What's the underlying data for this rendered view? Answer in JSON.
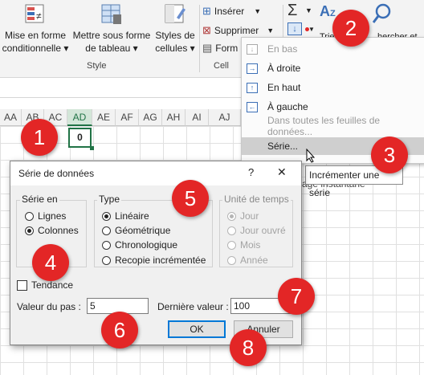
{
  "ribbon": {
    "btn_mise_forme": "Mise en forme",
    "btn_mise_forme_2": "conditionnelle",
    "btn_tableau": "Mettre sous forme",
    "btn_tableau_2": "de tableau",
    "btn_styles": "Styles de",
    "btn_styles_2": "cellules",
    "group_style": "Style",
    "insert": "Insérer",
    "delete": "Supprimer",
    "format": "Form",
    "group_cells": "Cell",
    "sort_filter": "Trier",
    "find": "hercher et"
  },
  "fill_menu": {
    "items": [
      {
        "label": "En bas",
        "disabled": true,
        "icon": "fill-down-icon",
        "glyph": "↓"
      },
      {
        "label": "À droite",
        "disabled": false,
        "icon": "fill-right-icon",
        "glyph": "→"
      },
      {
        "label": "En haut",
        "disabled": false,
        "icon": "fill-up-icon",
        "glyph": "↑"
      },
      {
        "label": "À gauche",
        "disabled": false,
        "icon": "fill-left-icon",
        "glyph": "←"
      },
      {
        "label": "Dans toutes les feuilles de données...",
        "disabled": true
      },
      {
        "label": "Série...",
        "disabled": false,
        "highlighted": true
      },
      {
        "label": "sage instantané",
        "disabled": false
      }
    ]
  },
  "tooltip": "Incrémenter une série",
  "grid": {
    "columns": [
      "AA",
      "AB",
      "AC",
      "AD",
      "AE",
      "AF",
      "AG",
      "AH",
      "AI",
      "AJ"
    ],
    "selected_column": "AD",
    "active_cell_value": "0"
  },
  "dialog": {
    "title": "Série de données",
    "help": "?",
    "close": "✕",
    "serie_en": {
      "legend": "Série en",
      "options": [
        "Lignes",
        "Colonnes"
      ],
      "selected": "Colonnes"
    },
    "type": {
      "legend": "Type",
      "options": [
        "Linéaire",
        "Géométrique",
        "Chronologique",
        "Recopie incrémentée"
      ],
      "selected": "Linéaire"
    },
    "unite": {
      "legend": "Unité de temps",
      "options": [
        "Jour",
        "Jour ouvré",
        "Mois",
        "Année"
      ],
      "selected": "Jour"
    },
    "tendance": "Tendance",
    "pas_label": "Valeur du pas :",
    "pas_value": "5",
    "derniere_label": "Dernière valeur :",
    "derniere_value": "100",
    "ok": "OK",
    "annuler": "Annuler"
  },
  "badges": [
    "1",
    "2",
    "3",
    "4",
    "5",
    "6",
    "7",
    "8"
  ],
  "colors": {
    "badge": "#e32626",
    "excel_green": "#217346",
    "accent_blue": "#0078d7"
  }
}
